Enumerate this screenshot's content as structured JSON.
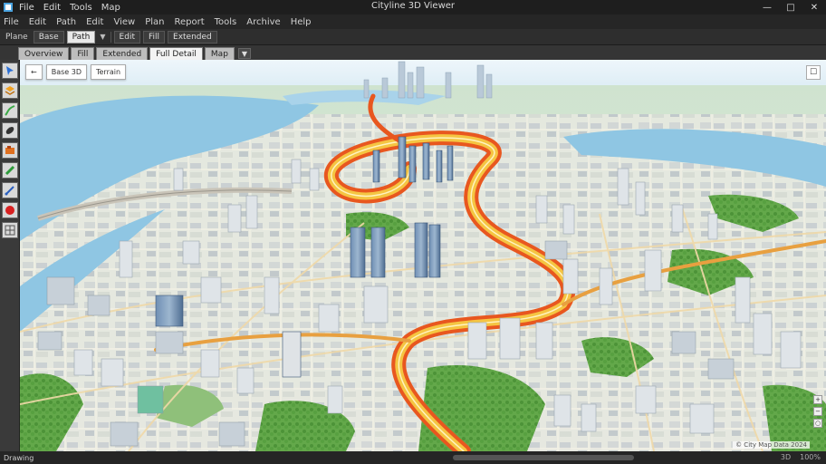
{
  "window": {
    "title": "Cityline 3D Viewer",
    "title_menu": [
      "File",
      "Edit",
      "Tools",
      "Map"
    ],
    "controls": [
      "minimize",
      "maximize",
      "close"
    ]
  },
  "menubar": [
    "File",
    "Edit",
    "Path",
    "Edit",
    "View",
    "Plan",
    "Report",
    "Tools",
    "Archive",
    "Help"
  ],
  "toolbar": {
    "mode_label": "Plane",
    "items": [
      "Base",
      "Path",
      "Edit",
      "Fill",
      "Extended"
    ]
  },
  "tabs": {
    "items": [
      "Overview",
      "Fill",
      "Extended",
      "Full Detail",
      "Map"
    ],
    "active_index": 3
  },
  "palette": {
    "tools": [
      "select-icon",
      "layers-icon",
      "route-icon",
      "marker-icon",
      "measure-icon",
      "draw-icon",
      "pin-icon",
      "grid-icon"
    ]
  },
  "map_controls": {
    "back_label": "←",
    "layer_label": "Base 3D",
    "view_label": "Terrain",
    "corner_icon": "expand-icon"
  },
  "zoom": {
    "in": "+",
    "out": "−",
    "reset": "○"
  },
  "attribution": "© City Map Data 2024",
  "status": {
    "left": "Drawing",
    "right": [
      "3D",
      "100%"
    ]
  },
  "colors": {
    "highway_outer": "#e8571f",
    "highway_inner": "#f5c542",
    "water": "#8fc6e3",
    "park": "#5ea845"
  }
}
